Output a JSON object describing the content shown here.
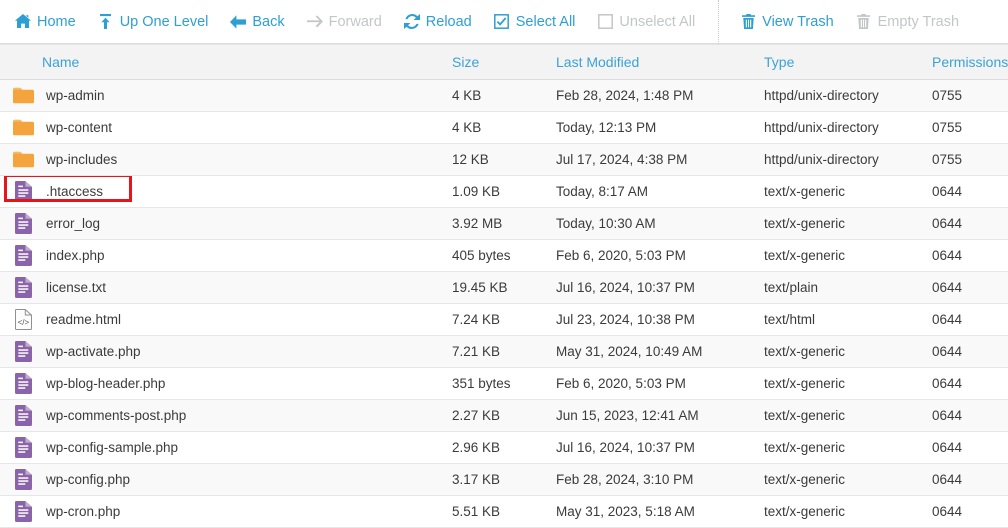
{
  "toolbar": {
    "groups": [
      {
        "buttons": [
          {
            "label": "Home",
            "icon": "home-icon",
            "state": "enabled"
          },
          {
            "label": "Up One Level",
            "icon": "arrow-up-icon",
            "state": "enabled"
          },
          {
            "label": "Back",
            "icon": "arrow-left-icon",
            "state": "enabled"
          },
          {
            "label": "Forward",
            "icon": "arrow-right-icon",
            "state": "disabled"
          },
          {
            "label": "Reload",
            "icon": "reload-icon",
            "state": "enabled"
          },
          {
            "label": "Select All",
            "icon": "checkbox-checked-icon",
            "state": "enabled"
          },
          {
            "label": "Unselect All",
            "icon": "checkbox-empty-icon",
            "state": "disabled"
          }
        ]
      },
      {
        "buttons": [
          {
            "label": "View Trash",
            "icon": "trash-icon",
            "state": "enabled"
          },
          {
            "label": "Empty Trash",
            "icon": "trash-icon",
            "state": "disabled"
          }
        ]
      }
    ]
  },
  "table": {
    "columns": [
      {
        "key": "name",
        "label": "Name"
      },
      {
        "key": "size",
        "label": "Size"
      },
      {
        "key": "modified",
        "label": "Last Modified"
      },
      {
        "key": "type",
        "label": "Type"
      },
      {
        "key": "permissions",
        "label": "Permissions"
      }
    ],
    "rows": [
      {
        "icon": "folder-icon",
        "name": "wp-admin",
        "size": "4 KB",
        "modified": "Feb 28, 2024, 1:48 PM",
        "type": "httpd/unix-directory",
        "permissions": "0755",
        "highlighted": false
      },
      {
        "icon": "folder-icon",
        "name": "wp-content",
        "size": "4 KB",
        "modified": "Today, 12:13 PM",
        "type": "httpd/unix-directory",
        "permissions": "0755",
        "highlighted": false
      },
      {
        "icon": "folder-icon",
        "name": "wp-includes",
        "size": "12 KB",
        "modified": "Jul 17, 2024, 4:38 PM",
        "type": "httpd/unix-directory",
        "permissions": "0755",
        "highlighted": false
      },
      {
        "icon": "text-file-icon",
        "name": ".htaccess",
        "size": "1.09 KB",
        "modified": "Today, 8:17 AM",
        "type": "text/x-generic",
        "permissions": "0644",
        "highlighted": true
      },
      {
        "icon": "text-file-icon",
        "name": "error_log",
        "size": "3.92 MB",
        "modified": "Today, 10:30 AM",
        "type": "text/x-generic",
        "permissions": "0644",
        "highlighted": false
      },
      {
        "icon": "text-file-icon",
        "name": "index.php",
        "size": "405 bytes",
        "modified": "Feb 6, 2020, 5:03 PM",
        "type": "text/x-generic",
        "permissions": "0644",
        "highlighted": false
      },
      {
        "icon": "text-file-icon",
        "name": "license.txt",
        "size": "19.45 KB",
        "modified": "Jul 16, 2024, 10:37 PM",
        "type": "text/plain",
        "permissions": "0644",
        "highlighted": false
      },
      {
        "icon": "html-file-icon",
        "name": "readme.html",
        "size": "7.24 KB",
        "modified": "Jul 23, 2024, 10:38 PM",
        "type": "text/html",
        "permissions": "0644",
        "highlighted": false
      },
      {
        "icon": "text-file-icon",
        "name": "wp-activate.php",
        "size": "7.21 KB",
        "modified": "May 31, 2024, 10:49 AM",
        "type": "text/x-generic",
        "permissions": "0644",
        "highlighted": false
      },
      {
        "icon": "text-file-icon",
        "name": "wp-blog-header.php",
        "size": "351 bytes",
        "modified": "Feb 6, 2020, 5:03 PM",
        "type": "text/x-generic",
        "permissions": "0644",
        "highlighted": false
      },
      {
        "icon": "text-file-icon",
        "name": "wp-comments-post.php",
        "size": "2.27 KB",
        "modified": "Jun 15, 2023, 12:41 AM",
        "type": "text/x-generic",
        "permissions": "0644",
        "highlighted": false
      },
      {
        "icon": "text-file-icon",
        "name": "wp-config-sample.php",
        "size": "2.96 KB",
        "modified": "Jul 16, 2024, 10:37 PM",
        "type": "text/x-generic",
        "permissions": "0644",
        "highlighted": false
      },
      {
        "icon": "text-file-icon",
        "name": "wp-config.php",
        "size": "3.17 KB",
        "modified": "Feb 28, 2024, 3:10 PM",
        "type": "text/x-generic",
        "permissions": "0644",
        "highlighted": false
      },
      {
        "icon": "text-file-icon",
        "name": "wp-cron.php",
        "size": "5.51 KB",
        "modified": "May 31, 2023, 5:18 AM",
        "type": "text/x-generic",
        "permissions": "0644",
        "highlighted": false
      }
    ]
  },
  "colors": {
    "link": "#2e9fd4",
    "header_text": "#3ba2d6",
    "disabled": "#c3c6c8",
    "folder": "#f5a33c",
    "text_file": "#8a63a8",
    "highlight_box": "#e8141b",
    "row_alt": "#f9f9f9",
    "header_bg": "#f3f3f3"
  }
}
